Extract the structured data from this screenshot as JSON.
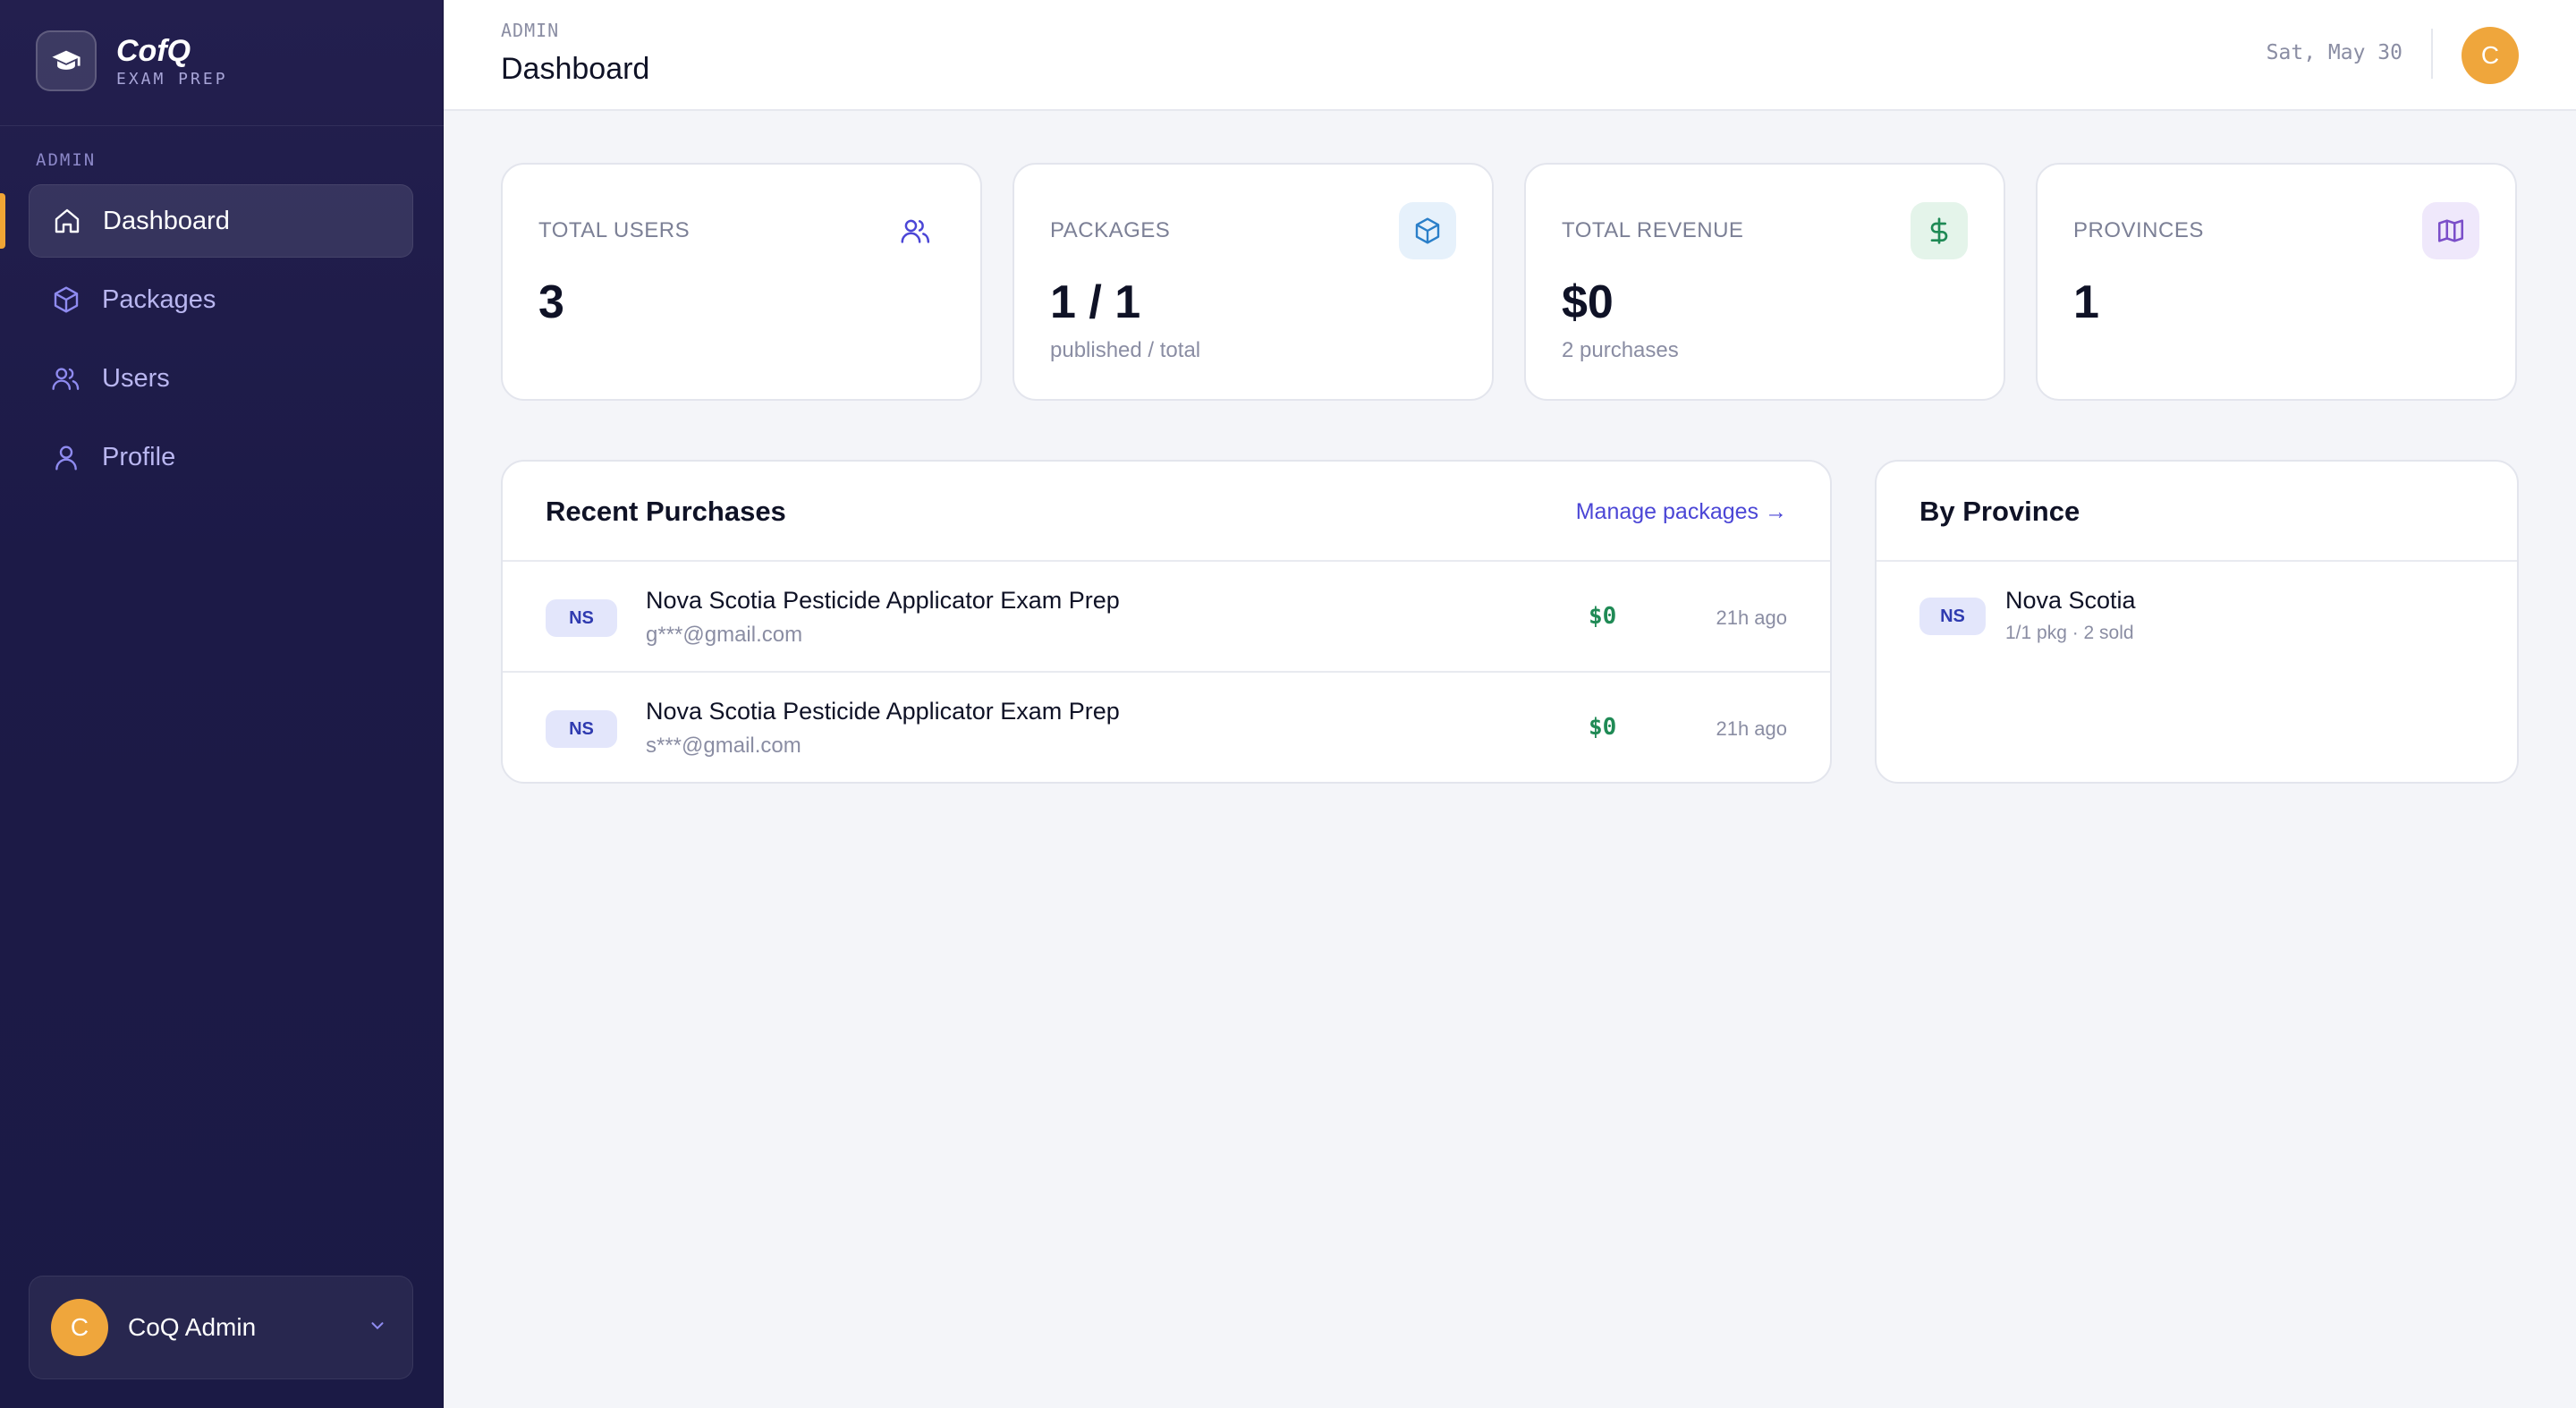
{
  "brand": {
    "name": "CofQ",
    "subtitle": "EXAM PREP",
    "logo_icon": "graduation-cap-icon"
  },
  "sidebar": {
    "section_label": "ADMIN",
    "items": [
      {
        "label": "Dashboard",
        "icon": "home-icon",
        "active": true
      },
      {
        "label": "Packages",
        "icon": "box-icon",
        "active": false
      },
      {
        "label": "Users",
        "icon": "users-icon",
        "active": false
      },
      {
        "label": "Profile",
        "icon": "user-icon",
        "active": false
      }
    ],
    "user": {
      "initial": "C",
      "name": "CoQ Admin"
    }
  },
  "header": {
    "breadcrumb": "ADMIN",
    "title": "Dashboard",
    "date": "Sat, May 30",
    "avatar_initial": "C"
  },
  "stats": [
    {
      "label": "TOTAL USERS",
      "value": "3",
      "sub": "",
      "icon": "users-icon"
    },
    {
      "label": "PACKAGES",
      "value": "1 / 1",
      "sub": "published / total",
      "icon": "box-icon"
    },
    {
      "label": "TOTAL REVENUE",
      "value": "$0",
      "sub": "2 purchases",
      "icon": "dollar-icon"
    },
    {
      "label": "PROVINCES",
      "value": "1",
      "sub": "",
      "icon": "map-icon"
    }
  ],
  "recent": {
    "title": "Recent Purchases",
    "link": "Manage packages →",
    "rows": [
      {
        "badge": "NS",
        "title": "Nova Scotia Pesticide Applicator Exam Prep",
        "email": "g***@gmail.com",
        "amount": "$0",
        "time": "21h ago"
      },
      {
        "badge": "NS",
        "title": "Nova Scotia Pesticide Applicator Exam Prep",
        "email": "s***@gmail.com",
        "amount": "$0",
        "time": "21h ago"
      }
    ]
  },
  "by_province": {
    "title": "By Province",
    "rows": [
      {
        "badge": "NS",
        "name": "Nova Scotia",
        "sub": "1/1 pkg · 2 sold"
      }
    ]
  },
  "colors": {
    "accent": "#4b46d6",
    "sidebar_bg": "#1c1a47",
    "avatar": "#efa63c",
    "money": "#1f8a55"
  }
}
